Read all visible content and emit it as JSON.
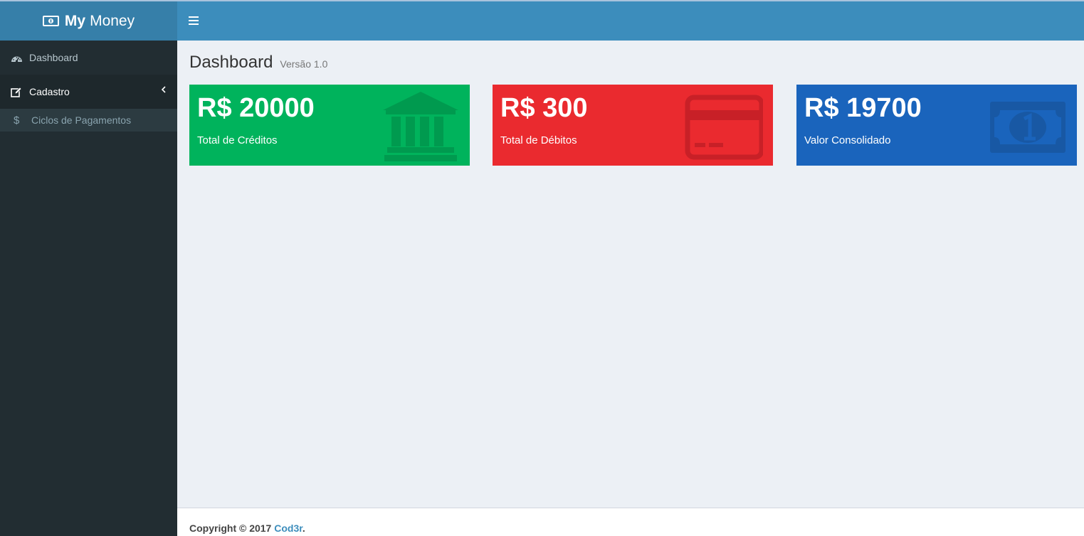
{
  "app": {
    "title_bold": "My",
    "title_rest": "Money"
  },
  "sidebar": {
    "items": [
      {
        "label": "Dashboard",
        "icon": "dashboard-icon"
      },
      {
        "label": "Cadastro",
        "icon": "edit-icon"
      }
    ],
    "subitems": [
      {
        "label": "Ciclos de Pagamentos",
        "icon": "dollar-icon"
      }
    ]
  },
  "page": {
    "title": "Dashboard",
    "subtitle": "Versão 1.0"
  },
  "boxes": [
    {
      "value": "R$ 20000",
      "label": "Total de Créditos",
      "color": "#00b35c",
      "icon": "bank-icon"
    },
    {
      "value": "R$ 300",
      "label": "Total de Débitos",
      "color": "#ea2a2f",
      "icon": "credit-card-icon"
    },
    {
      "value": "R$ 19700",
      "label": "Valor Consolidado",
      "color": "#1a64bc",
      "icon": "money-icon"
    }
  ],
  "footer": {
    "prefix": "Copyright © 2017",
    "link": "Cod3r",
    "suffix": "."
  },
  "colors": {
    "header": "#3c8dbc",
    "logo": "#367fa9",
    "sidebar": "#222d32",
    "content_bg": "#ecf0f5"
  }
}
